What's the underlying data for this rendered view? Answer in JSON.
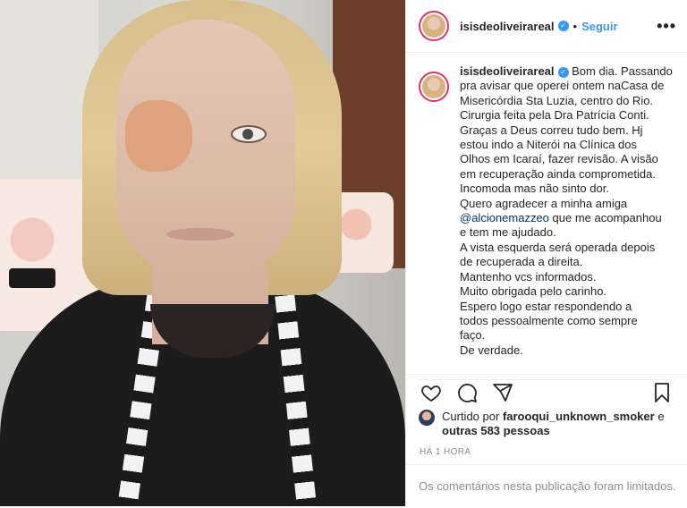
{
  "post": {
    "username": "isisdeoliveirareal",
    "follow_label": "Seguir",
    "caption_lines": [
      "Bom dia. Passando",
      "pra avisar que operei ontem naCasa de",
      "Misericórdia Sta Luzia, centro do Rio.",
      "Cirurgia feita pela Dra Patrícia Conti.",
      "Graças a Deus correu tudo bem. Hj",
      "estou indo a Niterói na Clínica dos",
      "Olhos em Icaraí, fazer revisão. A visão",
      "em recuperação ainda comprometida.",
      "Incomoda mas não sinto dor.",
      "Quero agradecer a minha amiga"
    ],
    "mention": "@alcionemazzeo",
    "caption_after_mention": [
      " que me acompanhou",
      "e tem me ajudado.",
      "A vista esquerda será operada depois",
      "de recuperada a direita.",
      "Mantenho vcs informados.",
      "Muito obrigada pelo carinho.",
      "Espero logo estar respondendo a",
      "todos pessoalmente como sempre",
      "faço.",
      "De verdade."
    ],
    "likes": {
      "prefix": "Curtido por",
      "user": "farooqui_unknown_smoker",
      "joiner": "e",
      "others": "outras 583 pessoas"
    },
    "time": "HÁ 1 HORA",
    "comments_notice": "Os comentários nesta publicação foram limitados."
  },
  "icons": {
    "verified": "verified-badge-icon",
    "more": "more-options-icon",
    "like": "heart-icon",
    "comment": "comment-icon",
    "share": "share-icon",
    "save": "bookmark-icon"
  },
  "colors": {
    "link": "#3897f0",
    "text": "#262626",
    "muted": "#8e8e8e",
    "story_ring": "#e1306c"
  }
}
